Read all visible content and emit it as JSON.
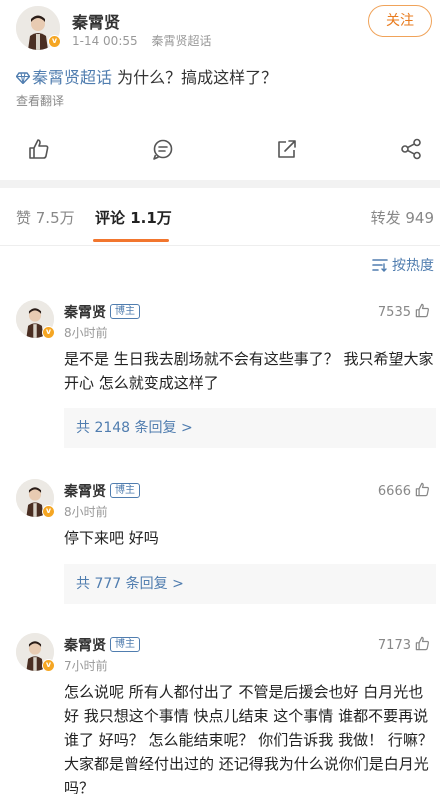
{
  "post": {
    "author": "秦霄贤",
    "time": "1-14 00:55",
    "source": "秦霄贤超话",
    "follow_label": "关注",
    "topic": "秦霄贤超话",
    "text": " 为什么？搞成这样了？",
    "translate": "查看翻译"
  },
  "tabs": {
    "likes": "赞 7.5万",
    "comments": "评论 1.1万",
    "reposts": "转发 949"
  },
  "sort_label": "按热度",
  "comments": [
    {
      "name": "秦霄贤",
      "badge": "博主",
      "time": "8小时前",
      "likes": "7535",
      "text": "是不是 生日我去剧场就不会有这些事了？  我只希望大家开心  怎么就变成这样了",
      "replies": "共 2148 条回复 >"
    },
    {
      "name": "秦霄贤",
      "badge": "博主",
      "time": "8小时前",
      "likes": "6666",
      "text": "停下来吧 好吗",
      "replies": "共 777 条回复 >"
    },
    {
      "name": "秦霄贤",
      "badge": "博主",
      "time": "7小时前",
      "likes": "7173",
      "text": "怎么说呢 所有人都付出了 不管是后援会也好  白月光也好 我只想这个事情  快点儿结束  这个事情 谁都不要再说谁了 好吗？ 怎么能结束呢？ 你们告诉我 我做！ 行嘛？  大家都是曾经付出过的 还记得我为什么说你们是白月光吗？"
    }
  ],
  "colors": {
    "accent": "#f2762e",
    "link": "#507daf",
    "verified": "#f5a623"
  }
}
